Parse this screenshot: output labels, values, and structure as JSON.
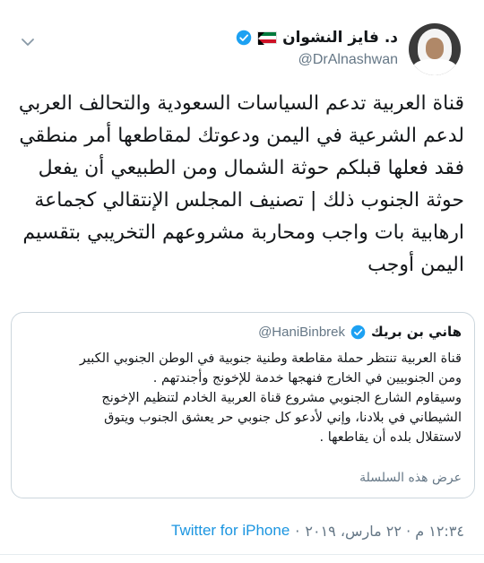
{
  "author": {
    "display_name": "د. فايز النشوان",
    "handle": "@DrAlnashwan",
    "flag_icon": "kuwait-flag-icon",
    "verified": true
  },
  "tweet": {
    "text": "قناة العربية تدعم السياسات السعودية والتحالف العربي لدعم الشرعية في اليمن ودعوتك لمقاطعها أمر منطقي فقد فعلها قبلكم حوثة الشمال ومن الطبيعي أن يفعل حوثة الجنوب ذلك | تصنيف المجلس الإنتقالي كجماعة ارهابية بات واجب ومحاربة مشروعهم التخريبي بتقسيم اليمن أوجب"
  },
  "quoted_tweet": {
    "display_name": "هاني بن بريك",
    "handle": "@HaniBinbrek",
    "verified": true,
    "text_lines": [
      "قناة العربية تنتظر حملة مقاطعة وطنية جنوبية في الوطن الجنوبي الكبير",
      "ومن الجنوبيين في الخارج فنهجها خدمة للإخونج وأجندتهم .",
      "وسيقاوم الشارع الجنوبي مشروع قناة العربية الخادم لتنظيم الإخونج",
      "الشيطاني في بلادنا، وإني لأدعو كل جنوبي حر يعشق الجنوب ويتوق",
      "لاستقلال بلده أن يقاطعها ."
    ],
    "show_thread_label": "عرض هذه السلسلة"
  },
  "footer": {
    "time_date": "١٢:٣٤ م · ٢٢ مارس، ٢٠١٩",
    "separator": "·",
    "source": "Twitter for iPhone"
  },
  "colors": {
    "verified_blue": "#1da1f2",
    "link_blue": "#1b95e0",
    "secondary_text": "#657786",
    "border": "#ccd6dd"
  }
}
